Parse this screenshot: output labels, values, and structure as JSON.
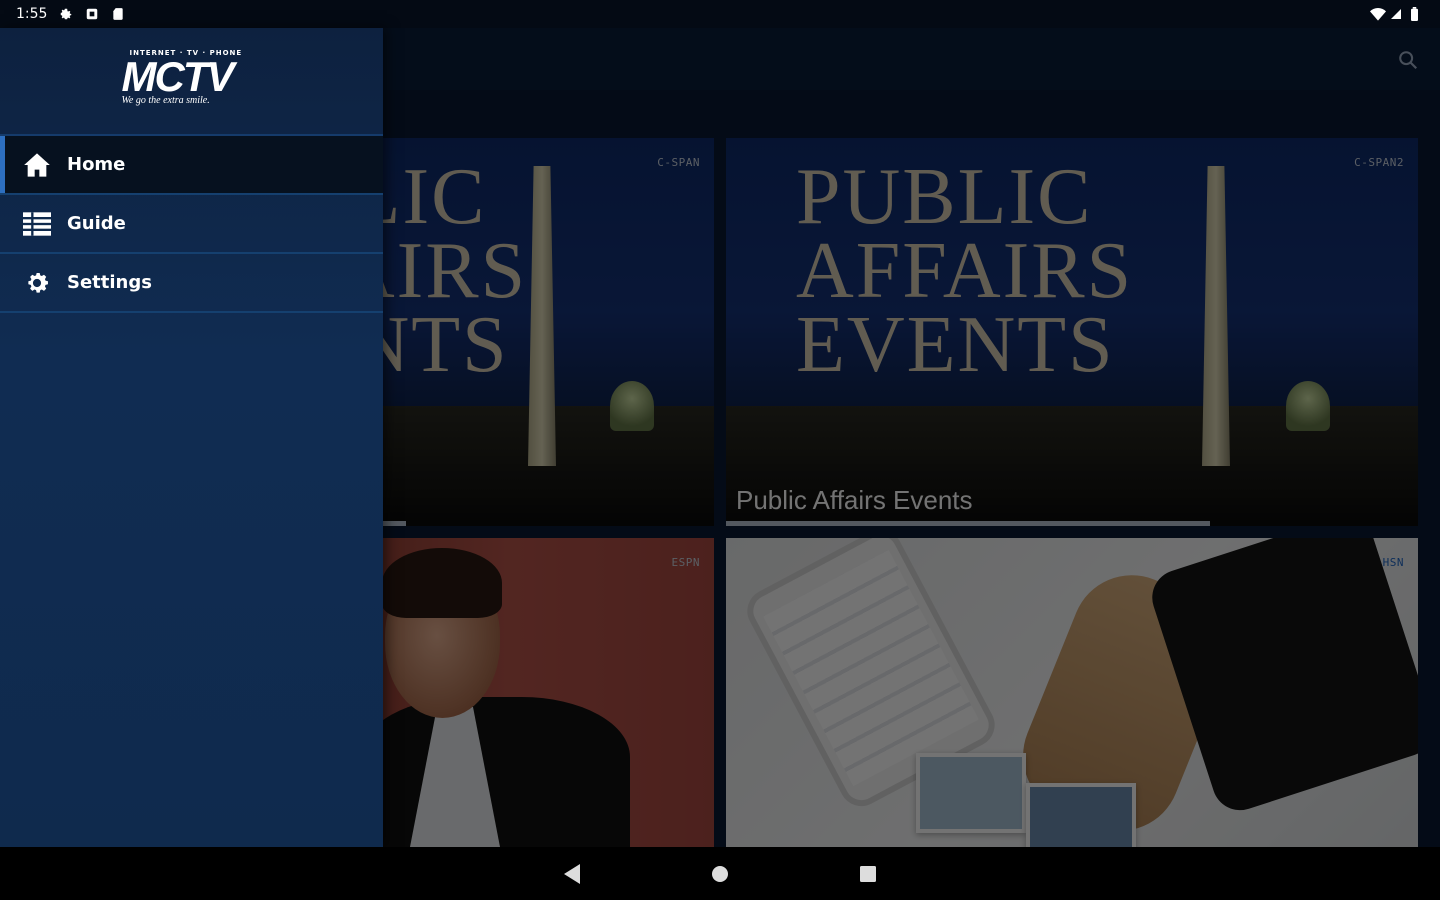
{
  "status_bar": {
    "time": "1:55"
  },
  "drawer": {
    "logo": {
      "tagline_top": "INTERNET · TV · PHONE",
      "wordmark": "MCTV",
      "tagline_bottom": "We go the extra smile."
    },
    "items": [
      {
        "label": "Home",
        "icon": "home-icon",
        "active": true
      },
      {
        "label": "Guide",
        "icon": "list-icon",
        "active": false
      },
      {
        "label": "Settings",
        "icon": "gear-icon",
        "active": false
      }
    ]
  },
  "content": {
    "tiles": [
      {
        "channel": "C-SPAN",
        "caption": "",
        "big_title": "",
        "progress": 0.55
      },
      {
        "channel": "C-SPAN2",
        "caption": "Public Affairs Events",
        "big_title": "Public Affairs Events",
        "progress": 0.7
      },
      {
        "channel": "ESPN",
        "caption": "",
        "big_title": "",
        "progress": 0
      },
      {
        "channel": "HSN",
        "caption": "",
        "big_title": "",
        "progress": 0
      }
    ]
  },
  "colors": {
    "accent": "#2d6fc0",
    "drawer_bg": "#102c52",
    "active_bg": "#06111f"
  }
}
